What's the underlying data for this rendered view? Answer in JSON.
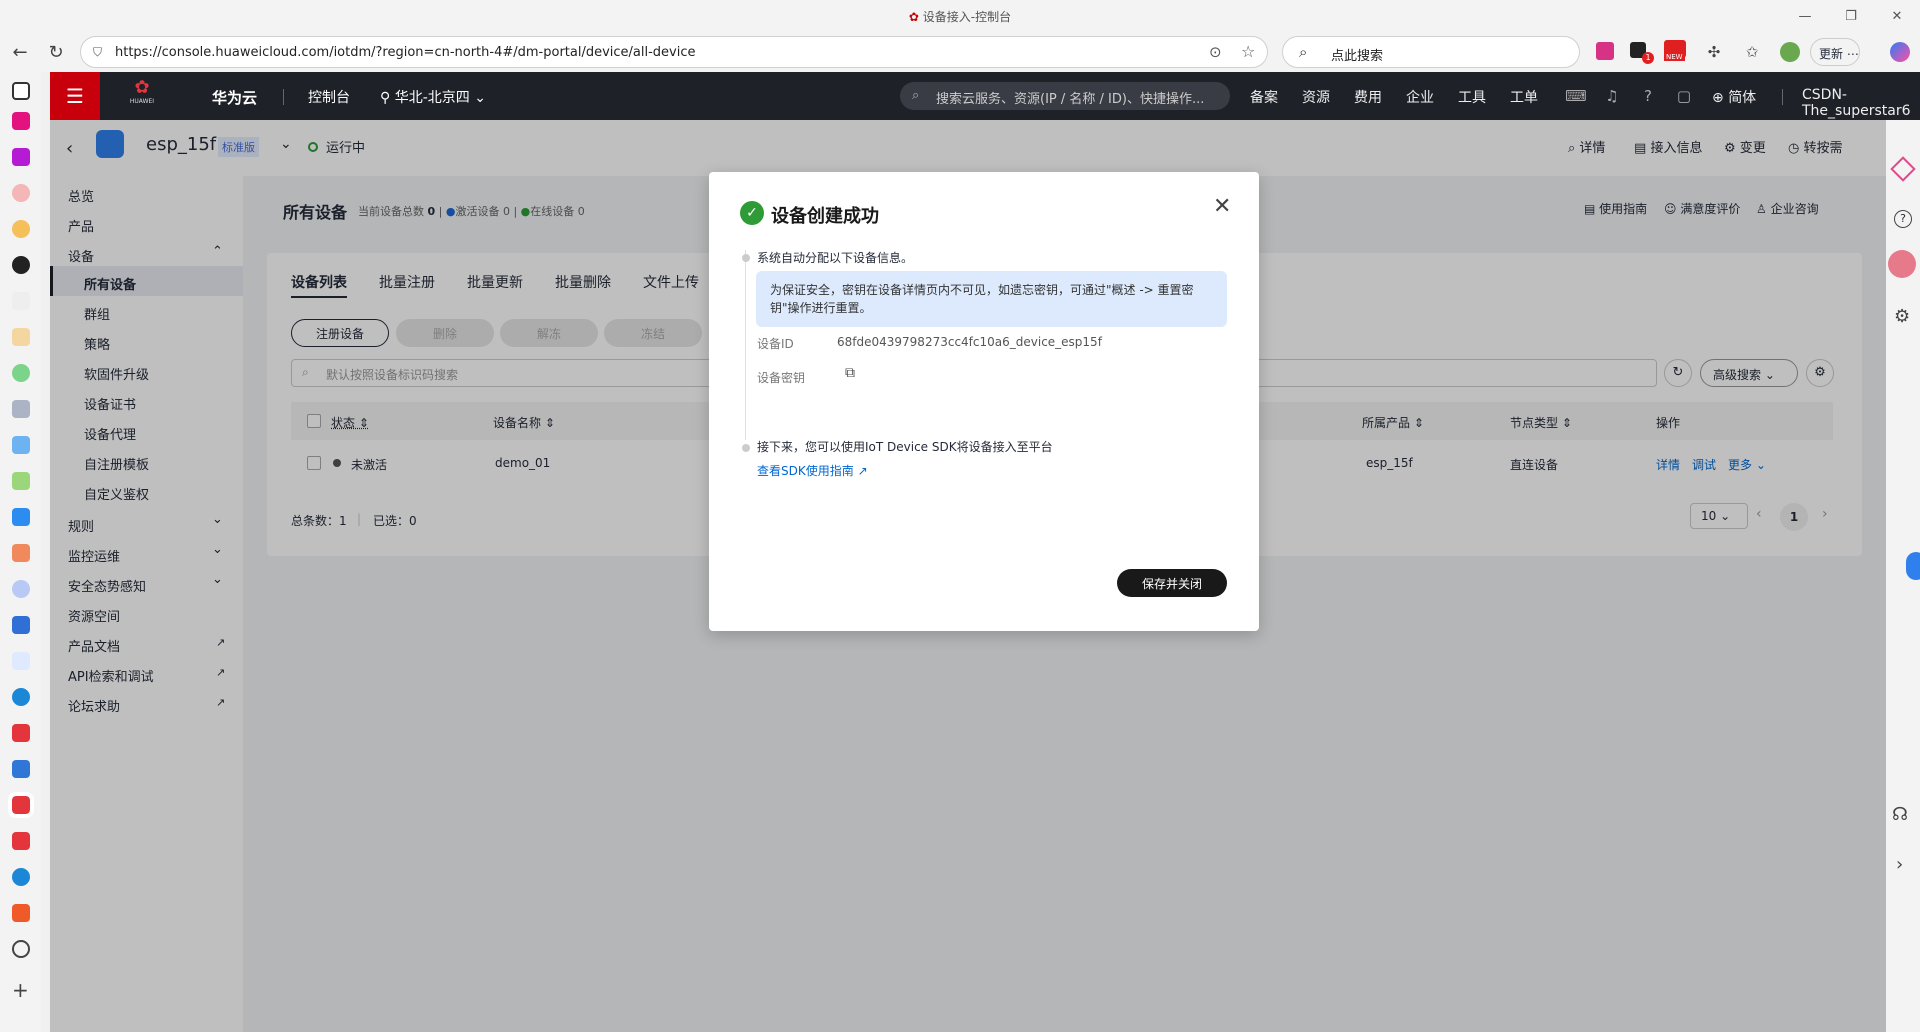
{
  "browser": {
    "window_title": "设备接入-控制台",
    "url": "https://console.huaweicloud.com/iotdm/?region=cn-north-4#/dm-portal/device/all-device",
    "search_placeholder": "点此搜索",
    "update_label": "更新",
    "notif_badge": "1",
    "new_badge": "NEW"
  },
  "console_header": {
    "brand": "华为云",
    "logo_text": "HUAWEI",
    "console": "控制台",
    "region": "华北-北京四",
    "search_placeholder": "搜索云服务、资源(IP / 名称 / ID)、快捷操作...",
    "links": [
      "备案",
      "资源",
      "费用",
      "企业",
      "工具",
      "工单"
    ],
    "lang": "简体",
    "user": "CSDN-The_superstar6"
  },
  "device_bar": {
    "name": "esp_15f",
    "edition": "标准版",
    "status": "运行中",
    "actions": [
      "详情",
      "接入信息",
      "变更",
      "转按需"
    ]
  },
  "sidebar": {
    "items": [
      {
        "label": "总览"
      },
      {
        "label": "产品"
      },
      {
        "label": "设备"
      },
      {
        "label": "所有设备"
      },
      {
        "label": "群组"
      },
      {
        "label": "策略"
      },
      {
        "label": "软固件升级"
      },
      {
        "label": "设备证书"
      },
      {
        "label": "设备代理"
      },
      {
        "label": "自注册模板"
      },
      {
        "label": "自定义鉴权"
      },
      {
        "label": "规则"
      },
      {
        "label": "监控运维"
      },
      {
        "label": "安全态势感知"
      },
      {
        "label": "资源空间"
      },
      {
        "label": "产品文档"
      },
      {
        "label": "API检索和调试"
      },
      {
        "label": "论坛求助"
      }
    ]
  },
  "page": {
    "title": "所有设备",
    "stat_total": "当前设备总数",
    "stat_total_val": "0",
    "stat_active": "激活设备",
    "stat_active_val": "0",
    "stat_online": "在线设备",
    "stat_online_val": "0",
    "top_links": [
      "使用指南",
      "满意度评价",
      "企业咨询"
    ],
    "tabs": [
      "设备列表",
      "批量注册",
      "批量更新",
      "批量删除",
      "文件上传"
    ],
    "buttons": [
      "注册设备",
      "删除",
      "解冻",
      "冻结"
    ],
    "search_placeholder": "默认按照设备标识码搜索",
    "advanced_search": "高级搜索",
    "columns": [
      "状态",
      "设备名称",
      "所属产品",
      "节点类型",
      "操作"
    ],
    "rows": [
      {
        "status": "未激活",
        "name": "demo_01",
        "product": "esp_15f",
        "node": "直连设备",
        "ops": [
          "详情",
          "调试",
          "更多"
        ]
      }
    ],
    "total_label": "总条数：",
    "total_val": "1",
    "selected_label": "已选：",
    "selected_val": "0",
    "page_size": "10",
    "current_page": "1"
  },
  "dialog": {
    "title": "设备创建成功",
    "step1": "系统自动分配以下设备信息。",
    "notice": "为保证安全，密钥在设备详情页内不可见，如遗忘密钥，可通过\"概述 -> 重置密钥\"操作进行重置。",
    "device_id_label": "设备ID",
    "device_id": "68fde0439798273cc4fc10a6_device_esp15f",
    "secret_label": "设备密钥",
    "step2": "接下来，您可以使用IoT Device SDK将设备接入至平台",
    "sdk_link": "查看SDK使用指南",
    "save_button": "保存并关闭"
  },
  "colors": {
    "header_bg": "#1f2129",
    "brand_red": "#c7000b",
    "success_green": "#2e9b36",
    "link_blue": "#0067d1",
    "notice_bg": "#ddeafd"
  }
}
